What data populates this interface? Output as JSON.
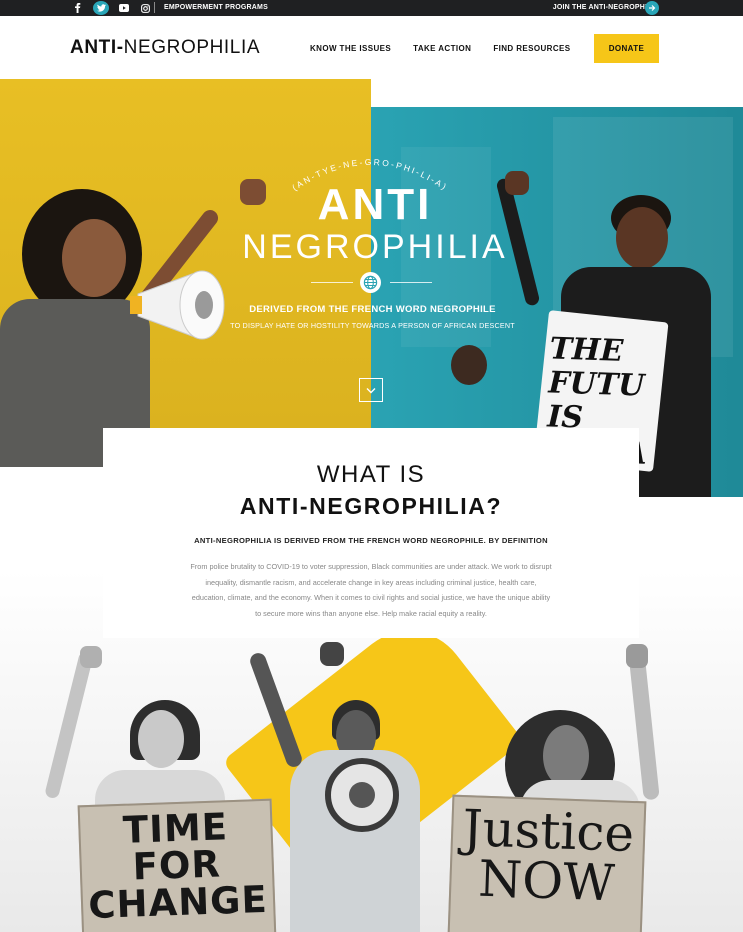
{
  "topbar": {
    "socials": [
      "facebook-icon",
      "twitter-icon",
      "youtube-icon",
      "instagram-icon"
    ],
    "empowerment_label": "EMPOWERMENT PROGRAMS",
    "join_label": "JOIN THE ANTI-NEGROPHILIA"
  },
  "header": {
    "logo_bold": "ANTI-",
    "logo_light": "NEGROPHILIA",
    "nav": [
      "KNOW THE ISSUES",
      "TAKE ACTION",
      "FIND RESOURCES"
    ],
    "donate_label": "DONATE"
  },
  "hero": {
    "pronunciation": "(AN-TYE-NE-GRO-PHI-LI-A)",
    "title_line1": "ANTI",
    "title_line2": "NEGROPHILIA",
    "derived": "DERIVED FROM THE FRENCH WORD NEGROPHILE",
    "meaning": "TO DISPLAY HATE OR HOSTILITY TOWARDS A PERSON OF AFRICAN DESCENT",
    "sign_text": "THE FUTU IS FEMA"
  },
  "intro": {
    "heading_line1": "WHAT IS",
    "heading_line2": "ANTI-NEGROPHILIA?",
    "definition": "ANTI-NEGROPHILIA IS DERIVED FROM THE FRENCH WORD NEGROPHILE. BY DEFINITION",
    "paragraph": "From police brutality to COVID-19 to voter suppression, Black communities are under attack. We work to disrupt inequality, dismantle racism, and accelerate change in key areas including criminal justice, health care, education, climate, and the economy. When it comes to civil rights and social justice, we have the unique ability to secure more wins than anyone else. Help make racial equity a reality."
  },
  "bottom": {
    "left_sign": "TIME FOR CHANGE",
    "right_sign": "Justice NOW"
  },
  "colors": {
    "accent_yellow": "#f6c618",
    "accent_teal": "#2aa3b3",
    "topbar_bg": "#1f2022"
  }
}
